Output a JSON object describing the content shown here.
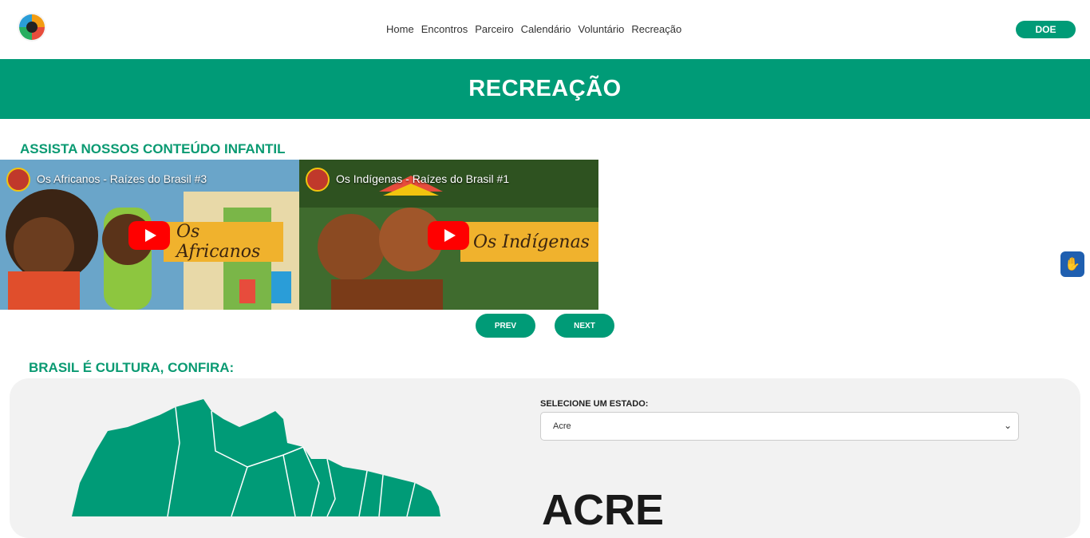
{
  "header": {
    "nav": [
      "Home",
      "Encontros",
      "Parceiro",
      "Calendário",
      "Voluntário",
      "Recreação"
    ],
    "donate_label": "DOE"
  },
  "banner": {
    "title": "RECREAÇÃO"
  },
  "kids": {
    "title": "ASSISTA NOSSOS CONTEÚDO INFANTIL",
    "videos": [
      {
        "title": "Os Africanos - Raízes do Brasil #3",
        "band": "Os Africanos"
      },
      {
        "title": "Os Indígenas - Raízes do Brasil #1",
        "band": "Os Indígenas"
      }
    ],
    "prev_label": "PREV",
    "next_label": "NEXT"
  },
  "culture": {
    "title": "BRASIL É CULTURA, CONFIRA:",
    "select_label": "SELECIONE UM ESTADO:",
    "selected_state": "Acre",
    "state_heading": "ACRE"
  },
  "colors": {
    "accent": "#009b77"
  },
  "icons": {
    "accessibility": "hand-sign-icon"
  }
}
